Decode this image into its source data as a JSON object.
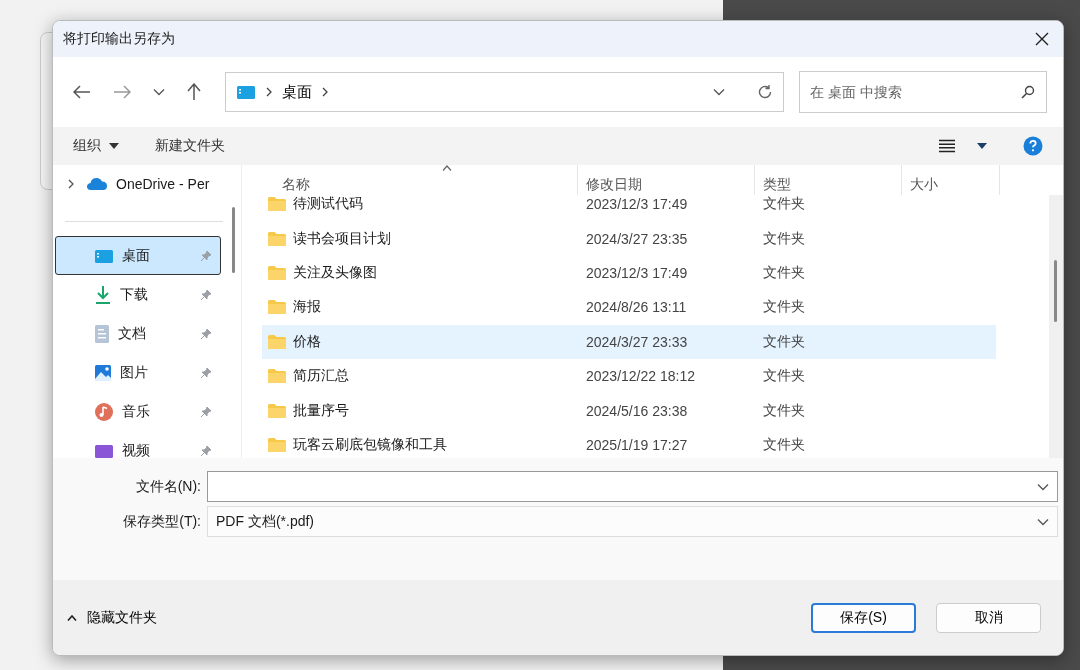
{
  "window": {
    "title": "将打印输出另存为"
  },
  "nav": {
    "breadcrumb": [
      {
        "label": "桌面"
      }
    ],
    "search": {
      "placeholder": "在 桌面 中搜索"
    }
  },
  "toolbar": {
    "organize": "组织",
    "new_folder": "新建文件夹"
  },
  "sidebar": {
    "items": [
      {
        "kind": "cloud",
        "label": "OneDrive - Per",
        "pinned": false,
        "selected": false
      },
      {
        "kind": "desktop",
        "label": "桌面",
        "pinned": true,
        "selected": true
      },
      {
        "kind": "download",
        "label": "下载",
        "pinned": true,
        "selected": false
      },
      {
        "kind": "document",
        "label": "文档",
        "pinned": true,
        "selected": false
      },
      {
        "kind": "image",
        "label": "图片",
        "pinned": true,
        "selected": false
      },
      {
        "kind": "music",
        "label": "音乐",
        "pinned": true,
        "selected": false
      },
      {
        "kind": "video",
        "label": "视频",
        "pinned": true,
        "selected": false
      }
    ]
  },
  "table": {
    "columns": [
      "名称",
      "修改日期",
      "类型",
      "大小"
    ],
    "rows": [
      {
        "name": "待测试代码",
        "modified": "2023/12/3 17:49",
        "type": "文件夹",
        "selected": false
      },
      {
        "name": "读书会项目计划",
        "modified": "2024/3/27 23:35",
        "type": "文件夹",
        "selected": false
      },
      {
        "name": "关注及头像图",
        "modified": "2023/12/3 17:49",
        "type": "文件夹",
        "selected": false
      },
      {
        "name": "海报",
        "modified": "2024/8/26 13:11",
        "type": "文件夹",
        "selected": false
      },
      {
        "name": "价格",
        "modified": "2024/3/27 23:33",
        "type": "文件夹",
        "selected": true
      },
      {
        "name": "简历汇总",
        "modified": "2023/12/22 18:12",
        "type": "文件夹",
        "selected": false
      },
      {
        "name": "批量序号",
        "modified": "2024/5/16 23:38",
        "type": "文件夹",
        "selected": false
      },
      {
        "name": "玩客云刷底包镜像和工具",
        "modified": "2025/1/19 17:27",
        "type": "文件夹",
        "selected": false
      }
    ]
  },
  "form": {
    "filename": {
      "label": "文件名(N):"
    },
    "filetype": {
      "label": "保存类型(T):",
      "value": "PDF 文档(*.pdf)"
    }
  },
  "footer": {
    "hide_folders": "隐藏文件夹",
    "buttons": [
      {
        "kind": "primary",
        "label": "保存(S)"
      },
      {
        "kind": "secondary",
        "label": "取消"
      }
    ]
  }
}
